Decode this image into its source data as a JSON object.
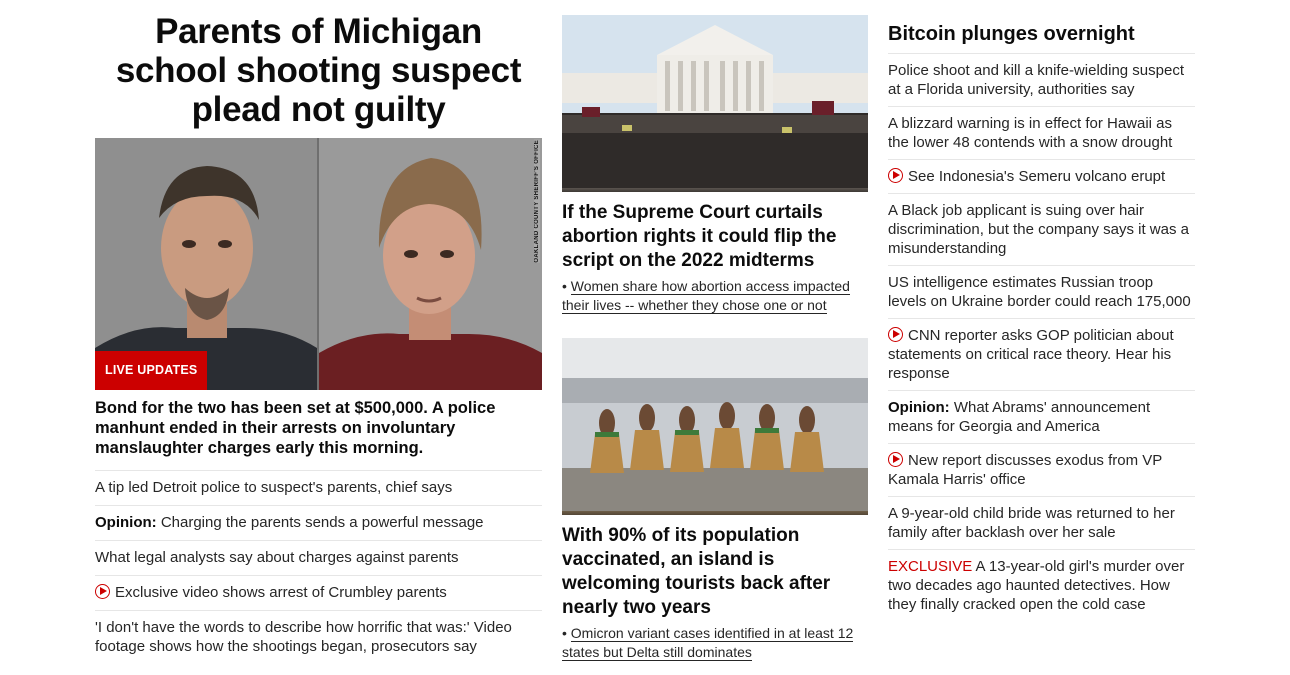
{
  "col1": {
    "headline": "Parents of Michigan school shooting suspect plead not guilty",
    "photo_credit": "OAKLAND COUNTY SHERIFF'S OFFICE",
    "live_badge": "LIVE UPDATES",
    "summary": "Bond for the two has been set at $500,000. A police manhunt ended in their arrests on involuntary manslaughter charges early this morning.",
    "items": [
      {
        "prefix": "",
        "text": "A tip led Detroit police to suspect's parents, chief says",
        "video": false
      },
      {
        "prefix": "Opinion:",
        "text": "Charging the parents sends a powerful message",
        "video": false
      },
      {
        "prefix": "",
        "text": "What legal analysts say about charges against parents",
        "video": false
      },
      {
        "prefix": "",
        "text": "Exclusive video shows arrest of Crumbley parents",
        "video": true
      },
      {
        "prefix": "",
        "text": "'I don't have the words to describe how horrific that was:' Video footage shows how the shootings began, prosecutors say",
        "video": false
      }
    ]
  },
  "col2": {
    "story1": {
      "headline": "If the Supreme Court curtails abortion rights it could flip the script on the 2022 midterms",
      "sub": "Women share how abortion access impacted their lives -- whether they chose one or not"
    },
    "story2": {
      "headline": "With 90% of its population vaccinated, an island is welcoming tourists back after nearly two years",
      "sub": "Omicron variant cases identified in at least 12 states but Delta still dominates"
    }
  },
  "col3": {
    "headline": "Bitcoin plunges overnight",
    "items": [
      {
        "text": "Police shoot and kill a knife-wielding suspect at a Florida university, authorities say"
      },
      {
        "text": "A blizzard warning is in effect for Hawaii as the lower 48 contends with a snow drought"
      },
      {
        "text": "See Indonesia's Semeru volcano erupt",
        "video": true
      },
      {
        "text": "A Black job applicant is suing over hair discrimination, but the company says it was a misunderstanding"
      },
      {
        "text": "US intelligence estimates Russian troop levels on Ukraine border could reach 175,000"
      },
      {
        "text": "CNN reporter asks GOP politician about statements on critical race theory. Hear his response",
        "video": true
      },
      {
        "prefix": "Opinion:",
        "text": "What Abrams' announcement means for Georgia and America"
      },
      {
        "text": "New report discusses exodus from VP Kamala Harris' office",
        "video": true
      },
      {
        "text": "A 9-year-old child bride was returned to her family after backlash over her sale"
      },
      {
        "exclusive": "EXCLUSIVE",
        "text": "A 13-year-old girl's murder over two decades ago haunted detectives. How they finally cracked open the cold case"
      }
    ]
  },
  "colors": {
    "brand_red": "#cc0000",
    "divider": "#e6e6e6"
  }
}
